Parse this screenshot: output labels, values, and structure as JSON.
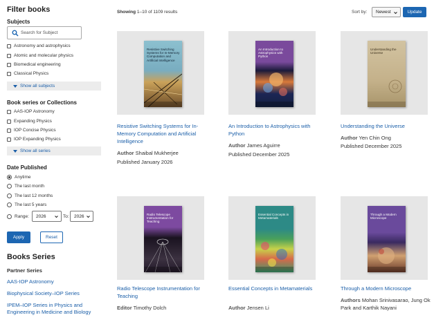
{
  "sidebar": {
    "filter_title": "Filter books",
    "subjects_title": "Subjects",
    "search_placeholder": "Search for Subject",
    "subjects": [
      "Astronomy and astrophysics",
      "Atomic and molecular physics",
      "Biomedical engineering",
      "Classical Physics"
    ],
    "show_all_subjects": "Show all subjects",
    "series_title": "Book series or Collections",
    "series": [
      "AAS-IOP Astronomy",
      "Expanding Physics",
      "IOP Concise Physics",
      "IOP Expanding Physics"
    ],
    "show_all_series": "Show all series",
    "date_title": "Date Published",
    "date_options": [
      "Anytime",
      "The last month",
      "The last 12 months",
      "The last 5 years"
    ],
    "date_selected": "Anytime",
    "range_label": "Range:",
    "range_from": "2026",
    "range_to_label": "To:",
    "range_to": "2026",
    "apply_label": "Apply",
    "reset_label": "Reset",
    "books_series_title": "Books Series",
    "partner_series_title": "Partner Series",
    "partner_series": [
      "AAS-IOP Astronomy",
      "Biophysical Society–IOP Series",
      "IPEM–IOP Series in Physics and Engineering in Medicine and Biology"
    ]
  },
  "toolbar": {
    "showing_label": "Showing",
    "showing_range": "1–10 of 1109 results",
    "sort_label": "Sort by:",
    "sort_value": "Newest",
    "update_label": "Update"
  },
  "books": [
    {
      "title": "Resistive Switching Systems for In-Memory Computation and Artificial Intelligence",
      "role": "Author",
      "people": "Shaibal Mukherjee",
      "published": "Published January 2026",
      "cover_title": "Resistive Switching Systems for In-Memory Computation and Artificial Intelligence",
      "cover_color": "#7eb3c3"
    },
    {
      "title": "An Introduction to Astrophysics with Python",
      "role": "Author",
      "people": "James Aguirre",
      "published": "Published December 2025",
      "cover_title": "An Introduction to Astrophysics with Python",
      "cover_color": "#7a4a9c"
    },
    {
      "title": "Understanding the Universe",
      "role": "Author",
      "people": "Yen Chin Ong",
      "published": "Published December 2025",
      "cover_title": "Understanding the Universe",
      "cover_color": "#c9b894"
    },
    {
      "title": "Radio Telescope Instrumentation for Teaching",
      "role": "Editor",
      "people": "Timothy Dolch",
      "published": "",
      "cover_title": "Radio Telescope Instrumentation for Teaching",
      "cover_color": "#7d4aa0"
    },
    {
      "title": "Essential Concepts in Metamaterials",
      "role": "Author",
      "people": "Jensen Li",
      "published": "",
      "cover_title": "Essential Concepts in Metamaterials",
      "cover_color": "#2d8a86"
    },
    {
      "title": "Through a Modern Microscope",
      "role": "Authors",
      "people": "Mohan Srinivasarao, Jung Ok Park and Karthik Nayani",
      "published": "",
      "cover_title": "Through a Modern Microscope",
      "cover_color": "#6a4a9c"
    }
  ]
}
